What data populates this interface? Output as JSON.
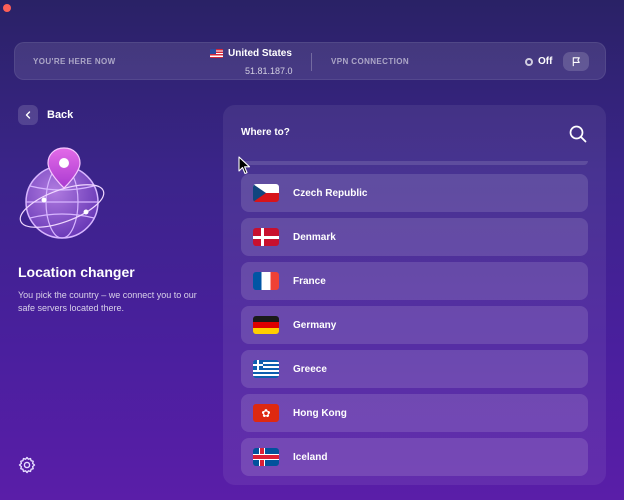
{
  "window": {
    "close_color": "#ff5f57"
  },
  "status_bar": {
    "location_label": "YOU'RE HERE NOW",
    "country": "United States",
    "country_flag_icon": "flag-us-icon",
    "ip": "51.81.187.0",
    "vpn_label": "VPN CONNECTION",
    "vpn_state": "Off",
    "flag_button_icon": "flag-icon"
  },
  "left_panel": {
    "back_label": "Back",
    "title": "Location changer",
    "description": "You pick the country – we connect you to our safe servers located there.",
    "illustration_icon": "globe-pin-icon",
    "settings_icon": "gear-icon"
  },
  "location_panel": {
    "heading": "Where to?",
    "search_icon": "search-icon",
    "countries": [
      {
        "name": "Czech Republic",
        "flag": "cz"
      },
      {
        "name": "Denmark",
        "flag": "dk"
      },
      {
        "name": "France",
        "flag": "fr"
      },
      {
        "name": "Germany",
        "flag": "de"
      },
      {
        "name": "Greece",
        "flag": "gr"
      },
      {
        "name": "Hong Kong",
        "flag": "hk"
      },
      {
        "name": "Iceland",
        "flag": "is"
      }
    ]
  },
  "colors": {
    "background_top": "#2a2266",
    "background_bottom": "#5a1ea8",
    "accent_pink": "#c74bd6"
  }
}
